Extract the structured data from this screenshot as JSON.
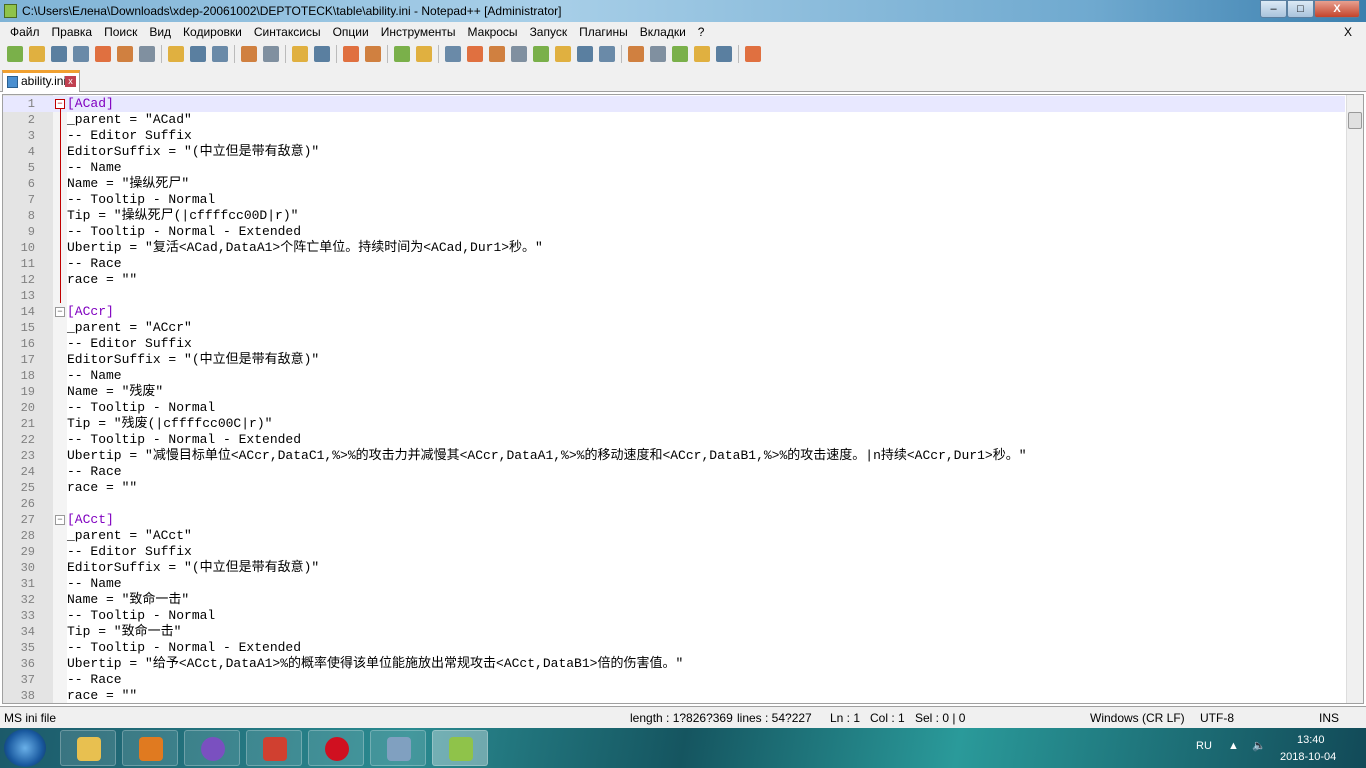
{
  "title": "C:\\Users\\Елена\\Downloads\\xdep-20061002\\DEPTOTECK\\table\\ability.ini - Notepad++ [Administrator]",
  "window_buttons": {
    "minimize": "–",
    "maximize": "□",
    "close": "X"
  },
  "menu": [
    "Файл",
    "Правка",
    "Поиск",
    "Вид",
    "Кодировки",
    "Синтаксисы",
    "Опции",
    "Инструменты",
    "Макросы",
    "Запуск",
    "Плагины",
    "Вкладки",
    "?"
  ],
  "menu_close": "X",
  "toolbar_icons": [
    "new-file",
    "open-file",
    "save",
    "save-all",
    "close",
    "close-all",
    "print",
    "|",
    "cut",
    "copy",
    "paste",
    "|",
    "undo",
    "redo",
    "|",
    "find",
    "replace",
    "|",
    "zoom-in",
    "zoom-out",
    "|",
    "sync-v",
    "sync-h",
    "|",
    "word-wrap",
    "show-all",
    "indent-guide",
    "udl",
    "doc-map",
    "function-list",
    "folder-workspace",
    "monitor",
    "|",
    "record",
    "stop",
    "play",
    "play-multiple",
    "save-macro",
    "|",
    "spell-check"
  ],
  "tab": {
    "label": "ability.ini",
    "close": "x"
  },
  "lines": [
    "[ACad]",
    "_parent = \"ACad\"",
    "-- Editor Suffix",
    "EditorSuffix = \"(中立但是带有敌意)\"",
    "-- Name",
    "Name = \"操纵死尸\"",
    "-- Tooltip - Normal",
    "Tip = \"操纵死尸(|cffffcc00D|r)\"",
    "-- Tooltip - Normal - Extended",
    "Ubertip = \"复活<ACad,DataA1>个阵亡单位。持续时间为<ACad,Dur1>秒。\"",
    "-- Race",
    "race = \"\"",
    "",
    "[ACcr]",
    "_parent = \"ACcr\"",
    "-- Editor Suffix",
    "EditorSuffix = \"(中立但是带有敌意)\"",
    "-- Name",
    "Name = \"残废\"",
    "-- Tooltip - Normal",
    "Tip = \"残废(|cffffcc00C|r)\"",
    "-- Tooltip - Normal - Extended",
    "Ubertip = \"减慢目标单位<ACcr,DataC1,%>%的攻击力并减慢其<ACcr,DataA1,%>%的移动速度和<ACcr,DataB1,%>%的攻击速度。|n持续<ACcr,Dur1>秒。\"",
    "-- Race",
    "race = \"\"",
    "",
    "[ACct]",
    "_parent = \"ACct\"",
    "-- Editor Suffix",
    "EditorSuffix = \"(中立但是带有敌意)\"",
    "-- Name",
    "Name = \"致命一击\"",
    "-- Tooltip - Normal",
    "Tip = \"致命一击\"",
    "-- Tooltip - Normal - Extended",
    "Ubertip = \"给予<ACct,DataA1>%的概率使得该单位能施放出常规攻击<ACct,DataB1>倍的伤害值。\"",
    "-- Race",
    "race = \"\""
  ],
  "status": {
    "type": "MS ini file",
    "length": "length : 1?826?369",
    "lines": "lines : 54?227",
    "ln": "Ln : 1",
    "col": "Col : 1",
    "sel": "Sel : 0 | 0",
    "eol": "Windows (CR LF)",
    "encoding": "UTF-8",
    "mode": "INS"
  },
  "tray": {
    "lang": "RU",
    "time": "13:40",
    "date": "2018-10-04"
  },
  "taskbar_apps": [
    "file-explorer",
    "media-player",
    "viber",
    "ccleaner",
    "opera",
    "paint",
    "notepad-plus-plus"
  ]
}
